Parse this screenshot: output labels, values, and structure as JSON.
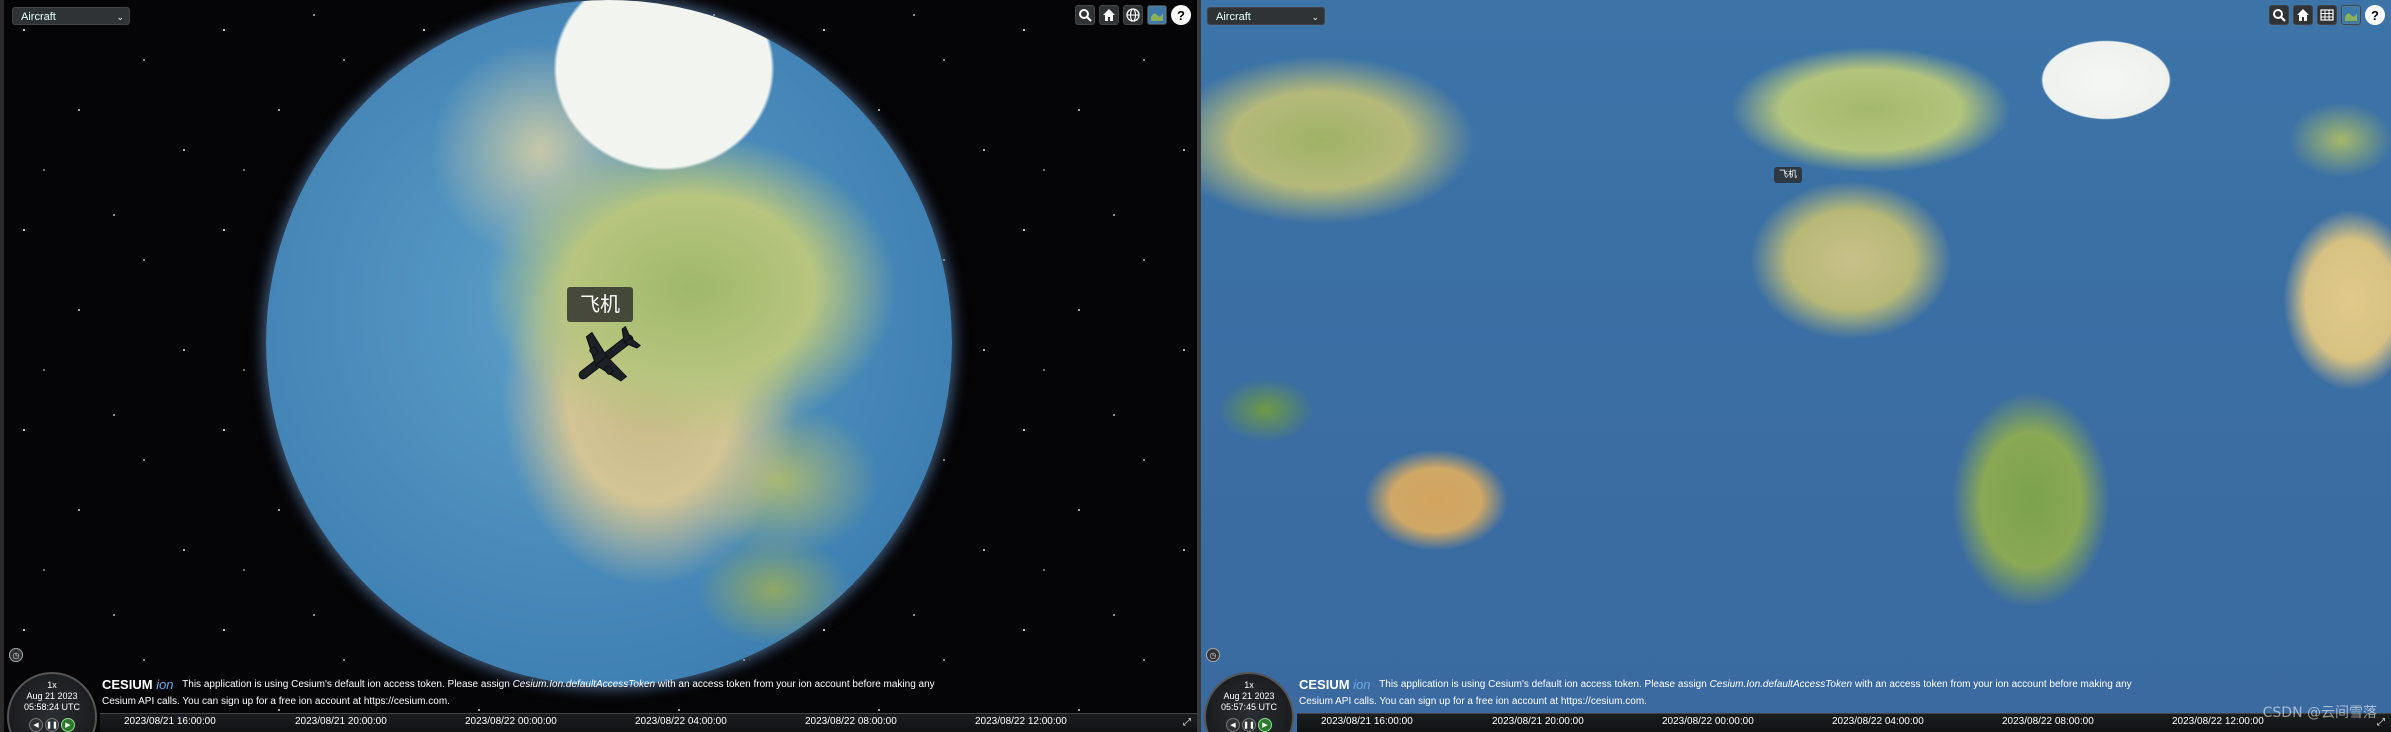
{
  "left_viewer": {
    "select_value": "Aircraft",
    "entity_label": "飞机",
    "clock": {
      "speed": "1x",
      "date": "Aug 21 2023",
      "time": "05:58:24 UTC"
    },
    "credits": {
      "line1_prefix": "This application is using Cesium's default ion access token. Please assign",
      "line1_code": "Cesium.Ion.defaultAccessToken",
      "line1_suffix": "with an access token from your ion account before making any",
      "line2": "Cesium API calls. You can sign up for a free ion account at https://cesium.com."
    },
    "timeline_ticks": [
      "2023/08/21 16:00:00",
      "2023/08/21 20:00:00",
      "2023/08/22 00:00:00",
      "2023/08/22 04:00:00",
      "2023/08/22 08:00:00",
      "2023/08/22 12:00:00"
    ]
  },
  "right_viewer": {
    "select_value": "Aircraft",
    "entity_label": "飞机",
    "clock": {
      "speed": "1x",
      "date": "Aug 21 2023",
      "time": "05:57:45 UTC"
    },
    "credits": {
      "line1_prefix": "This application is using Cesium's default ion access token. Please assign",
      "line1_code": "Cesium.Ion.defaultAccessToken",
      "line1_suffix": "with an access token from your ion account before making any",
      "line2": "Cesium API calls. You can sign up for a free ion account at https://cesium.com."
    },
    "timeline_ticks": [
      "2023/08/21 16:00:00",
      "2023/08/21 20:00:00",
      "2023/08/22 00:00:00",
      "2023/08/22 04:00:00",
      "2023/08/22 08:00:00",
      "2023/08/22 12:00:00"
    ]
  },
  "logo": {
    "cesium": "CESIUM",
    "ion": "ion"
  },
  "toolbar": {
    "help_label": "?"
  },
  "watermark": "CSDN @云间雪落",
  "icons": [
    "search-icon",
    "home-icon",
    "globe-icon",
    "grid-icon",
    "imagery-icon",
    "help-icon",
    "clock-icon",
    "play-reverse-icon",
    "pause-icon",
    "play-icon",
    "fullscreen-icon",
    "airplane-icon"
  ]
}
